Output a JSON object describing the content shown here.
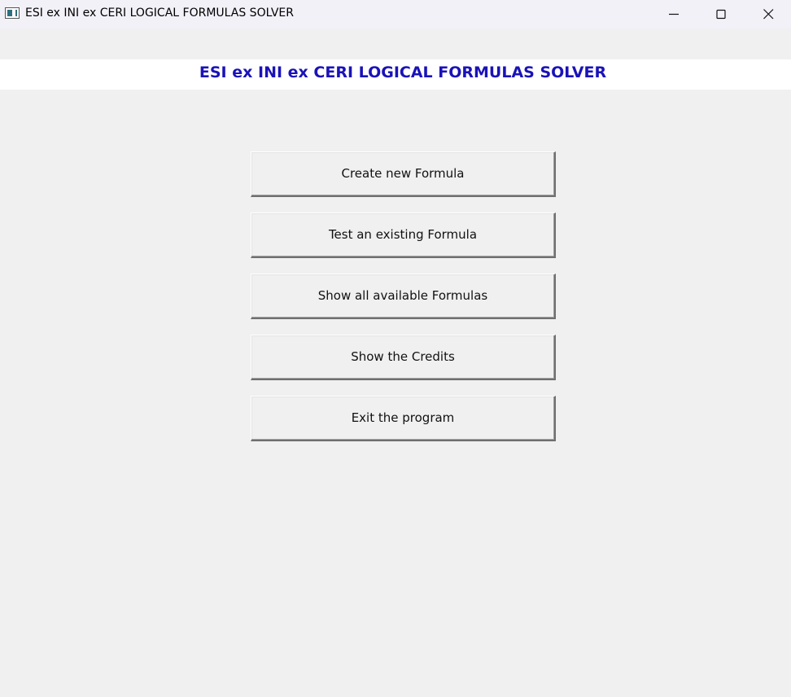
{
  "window": {
    "title": "ESI ex INI ex CERI LOGICAL FORMULAS SOLVER",
    "icon": "app-window-icon",
    "controls": [
      "minimize-icon",
      "maximize-icon",
      "close-icon"
    ]
  },
  "header": {
    "title": "ESI ex INI ex CERI LOGICAL FORMULAS SOLVER",
    "color": "#1a12b8"
  },
  "menu": {
    "buttons": [
      {
        "label": "Create new Formula"
      },
      {
        "label": "Test an existing Formula"
      },
      {
        "label": "Show all available Formulas"
      },
      {
        "label": "Show the Credits"
      },
      {
        "label": "Exit the program"
      }
    ]
  }
}
